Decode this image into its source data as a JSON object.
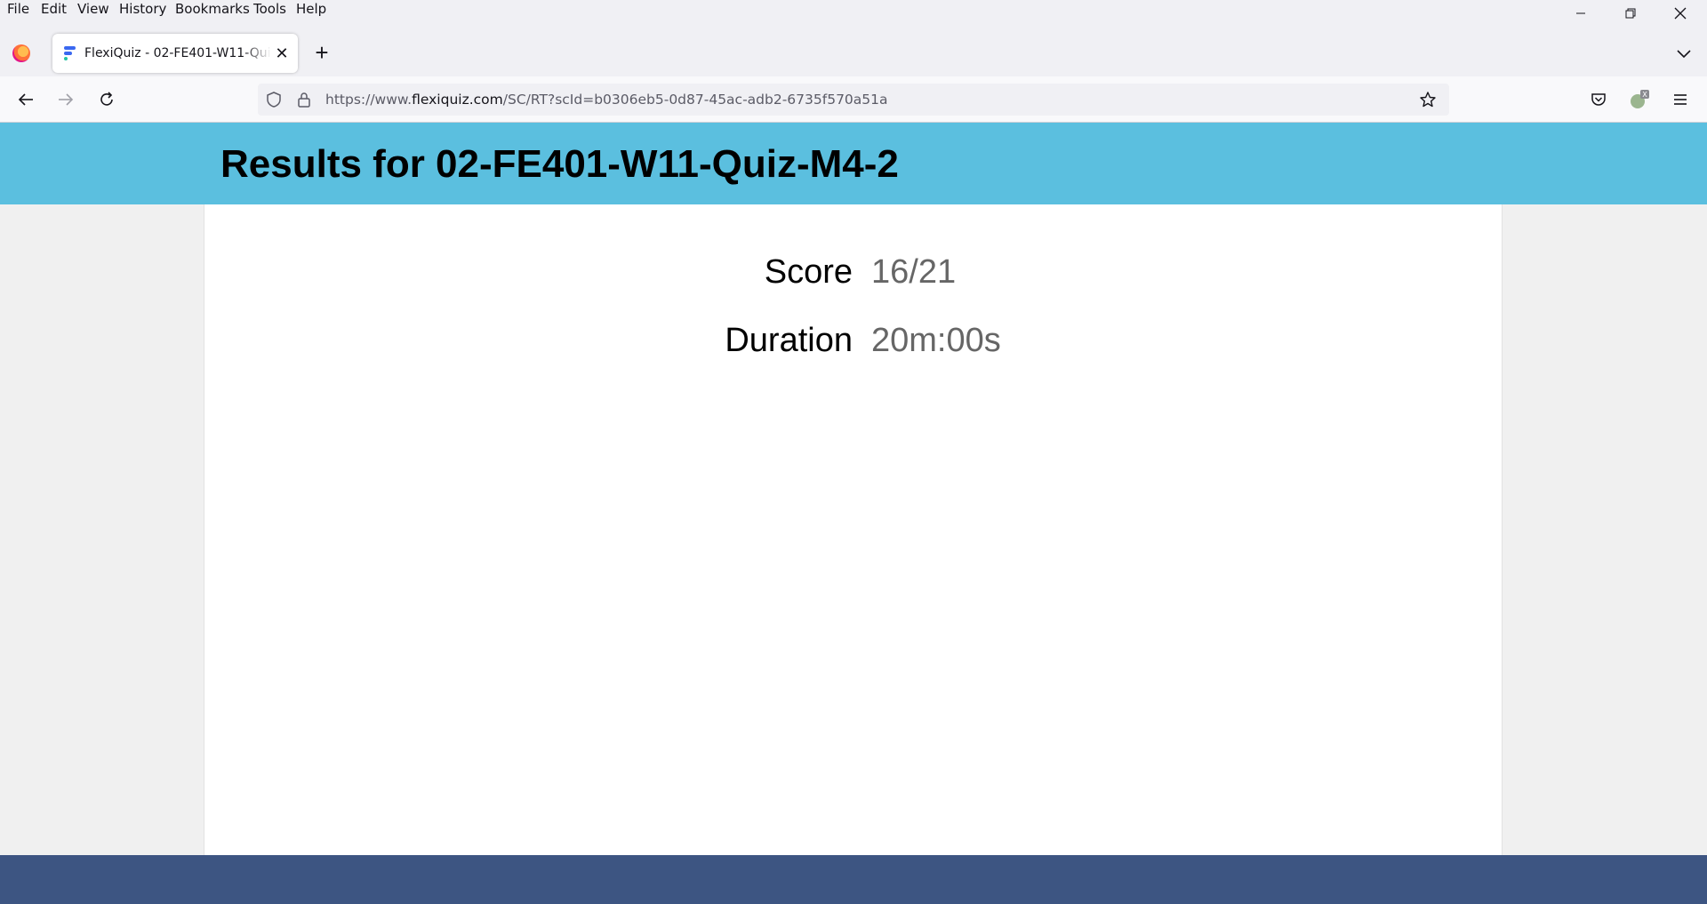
{
  "menu": {
    "items": [
      "File",
      "Edit",
      "View",
      "History",
      "Bookmarks",
      "Tools",
      "Help"
    ]
  },
  "tab": {
    "title": "FlexiQuiz - 02-FE401-W11-Quiz-M4-2",
    "favicon": "flexiquiz-icon"
  },
  "url": {
    "prefix": "https://www.",
    "host": "flexiquiz.com",
    "path": "/SC/RT?scId=b0306eb5-0d87-45ac-adb2-6735f570a51a"
  },
  "page": {
    "title": "Results for 02-FE401-W11-Quiz-M4-2",
    "score_label": "Score",
    "score_value": "16/21",
    "duration_label": "Duration",
    "duration_value": "20m:00s"
  },
  "colors": {
    "header_band": "#5bbfdf",
    "footer": "#3d5582",
    "value_text": "#666666"
  }
}
